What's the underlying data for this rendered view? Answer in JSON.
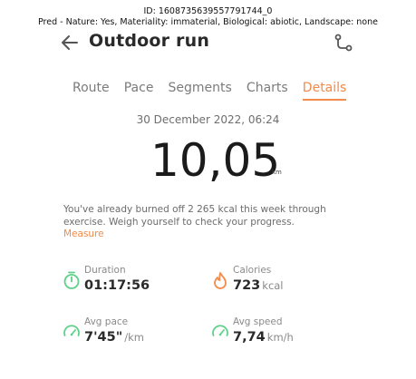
{
  "caption": {
    "id_line": "ID: 1608735639557791744_0",
    "pred_line": "Pred - Nature: Yes, Materiality: immaterial, Biological: abiotic, Landscape: none"
  },
  "header": {
    "title": "Outdoor run"
  },
  "tabs": [
    {
      "label": "Route",
      "active": false
    },
    {
      "label": "Pace",
      "active": false
    },
    {
      "label": "Segments",
      "active": false
    },
    {
      "label": "Charts",
      "active": false
    },
    {
      "label": "Details",
      "active": true
    }
  ],
  "summary": {
    "date": "30 December 2022, 06:24",
    "distance": "10,05",
    "distance_unit": "km"
  },
  "notice": {
    "text": "You've already burned off 2 265 kcal this week through exercise. Weigh yourself to check your progress.",
    "link": "Measure"
  },
  "stats": {
    "duration": {
      "label": "Duration",
      "value": "01:17:56",
      "unit": ""
    },
    "calories": {
      "label": "Calories",
      "value": "723",
      "unit": "kcal"
    },
    "avg_pace": {
      "label": "Avg pace",
      "value": "7'45\"",
      "unit": "/km"
    },
    "avg_speed": {
      "label": "Avg speed",
      "value": "7,74",
      "unit": "km/h"
    }
  },
  "colors": {
    "accent": "#f28b4c",
    "stat_icon": "#5fd08a"
  },
  "icons": {
    "back": "arrow-left-icon",
    "route": "route-icon",
    "duration": "stopwatch-icon",
    "calories": "flame-icon",
    "avg_pace": "speedometer-icon",
    "avg_speed": "speedometer-icon"
  }
}
